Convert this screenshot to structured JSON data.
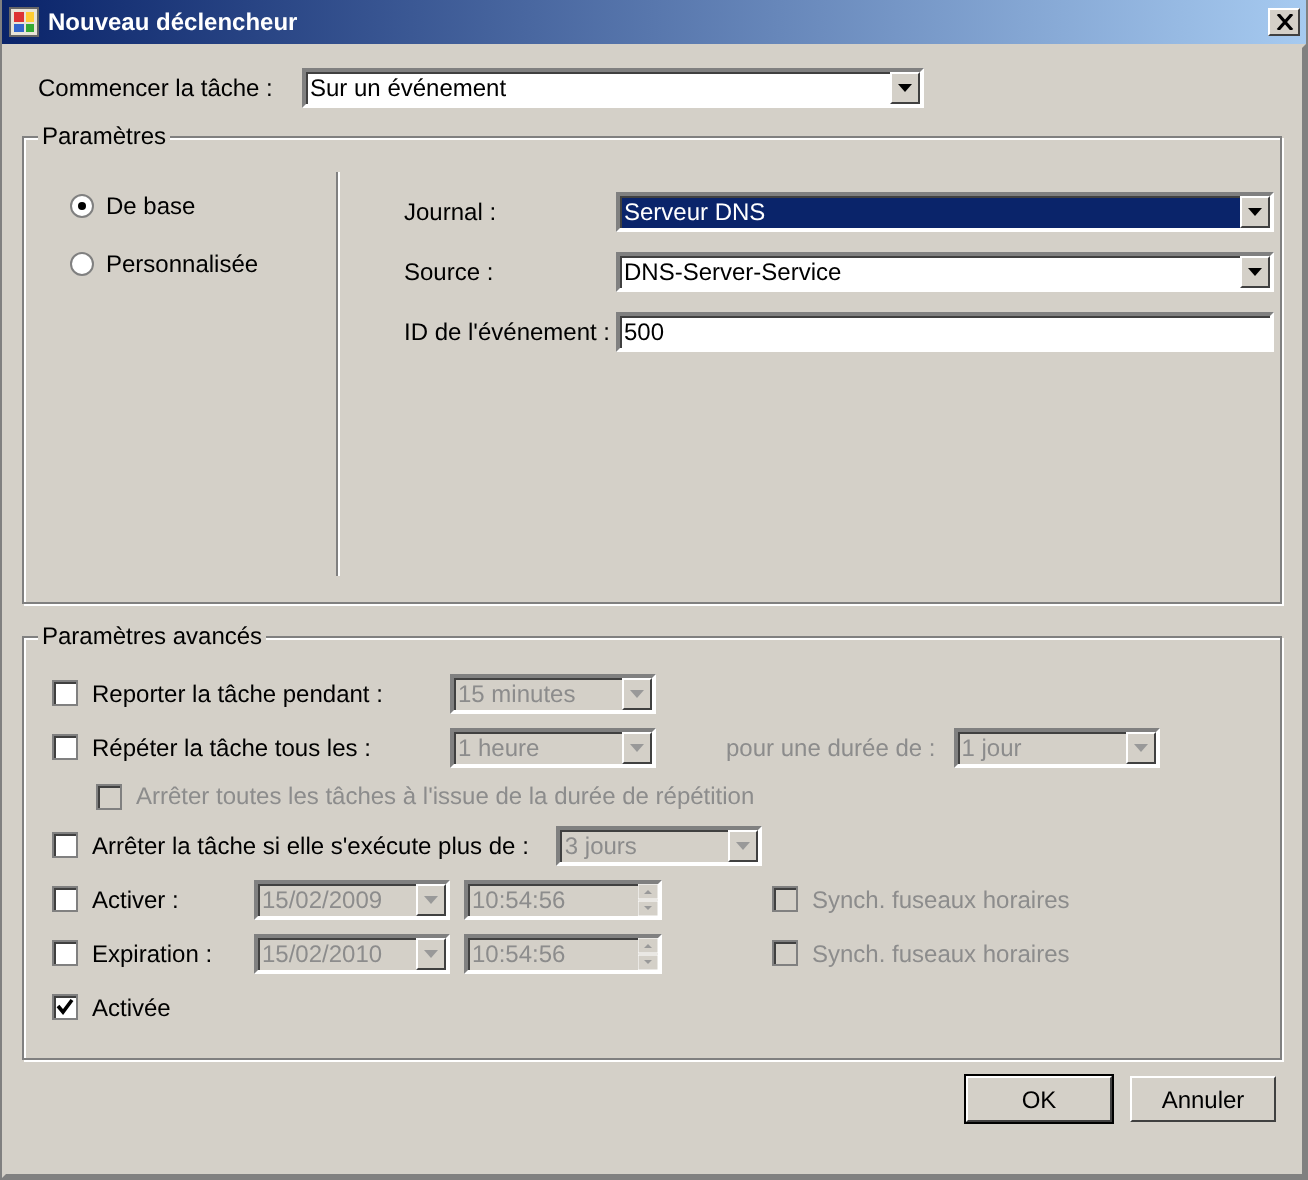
{
  "window": {
    "title": "Nouveau déclencheur"
  },
  "start_task": {
    "label": "Commencer la tâche :",
    "value": "Sur un événement"
  },
  "parameters": {
    "title": "Paramètres",
    "modes": [
      {
        "label": "De base",
        "selected": true
      },
      {
        "label": "Personnalisée",
        "selected": false
      }
    ],
    "fields": [
      {
        "kind": "combo",
        "label": "Journal :",
        "value": "Serveur DNS",
        "focused": true
      },
      {
        "kind": "combo",
        "label": "Source :",
        "value": "DNS-Server-Service",
        "focused": false
      },
      {
        "kind": "text",
        "label": "ID de l'événement :",
        "value": "500",
        "focused": false
      }
    ]
  },
  "advanced": {
    "title": "Paramètres avancés",
    "options": [
      {
        "label": "Reporter la tâche pendant :",
        "checked": false,
        "disabled": false,
        "indented": false,
        "controls": [
          {
            "kind": "combo",
            "value": "15 minutes",
            "disabled": true
          }
        ]
      },
      {
        "label": "Répéter la tâche tous les :",
        "checked": false,
        "disabled": false,
        "indented": false,
        "controls": [
          {
            "kind": "combo",
            "value": "1 heure",
            "disabled": true
          },
          {
            "kind": "label",
            "value": "pour une durée de :",
            "disabled": true
          },
          {
            "kind": "combo",
            "value": "1 jour",
            "disabled": true
          }
        ]
      },
      {
        "label": "Arrêter toutes les tâches à l'issue de la durée de répétition",
        "checked": false,
        "disabled": true,
        "indented": true
      },
      {
        "label": "Arrêter la tâche si elle s'exécute plus de :",
        "checked": false,
        "disabled": false,
        "indented": false,
        "controls": [
          {
            "kind": "combo",
            "value": "3 jours",
            "disabled": true
          }
        ]
      },
      {
        "label": "Activer :",
        "checked": false,
        "disabled": false,
        "indented": false,
        "controls": [
          {
            "kind": "date",
            "value": "15/02/2009",
            "disabled": true
          },
          {
            "kind": "time",
            "value": "10:54:56",
            "disabled": true
          },
          {
            "kind": "check",
            "value": "Synch. fuseaux horaires",
            "checked": false,
            "disabled": true
          }
        ]
      },
      {
        "label": "Expiration :",
        "checked": false,
        "disabled": false,
        "indented": false,
        "controls": [
          {
            "kind": "date",
            "value": "15/02/2010",
            "disabled": true
          },
          {
            "kind": "time",
            "value": "10:54:56",
            "disabled": true
          },
          {
            "kind": "check",
            "value": "Synch. fuseaux horaires",
            "checked": false,
            "disabled": true
          }
        ]
      },
      {
        "label": "Activée",
        "checked": true,
        "disabled": false,
        "indented": false
      }
    ]
  },
  "buttons": [
    {
      "label": "OK",
      "default": true
    },
    {
      "label": "Annuler",
      "default": false
    }
  ]
}
